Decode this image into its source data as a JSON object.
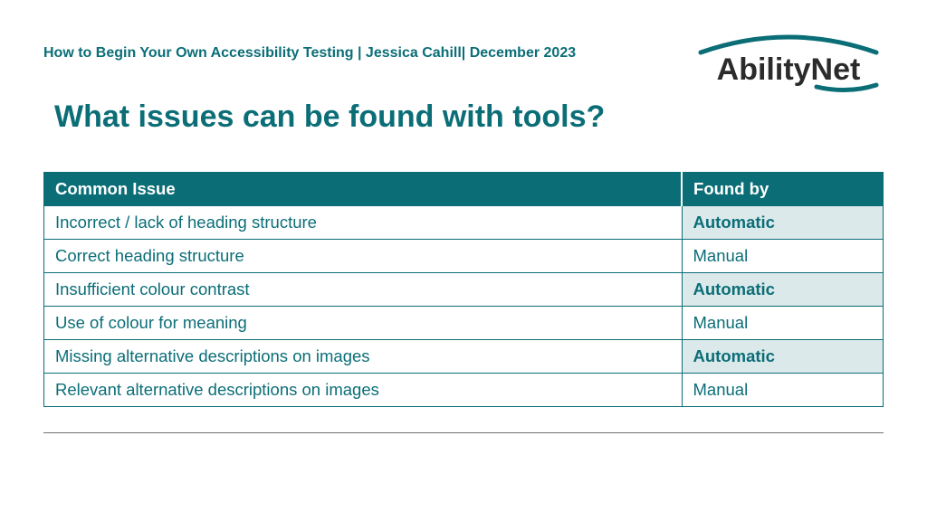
{
  "header": {
    "breadcrumb": "How to Begin Your Own Accessibility Testing | Jessica Cahill| December 2023",
    "logo_text": "AbilityNet"
  },
  "title": "What issues can be found with tools?",
  "table": {
    "headers": {
      "issue": "Common Issue",
      "found_by": "Found by"
    },
    "rows": [
      {
        "issue": "Incorrect / lack of heading structure",
        "found_by": "Automatic",
        "auto": true
      },
      {
        "issue": "Correct heading structure",
        "found_by": "Manual",
        "auto": false
      },
      {
        "issue": "Insufficient colour contrast",
        "found_by": "Automatic",
        "auto": true
      },
      {
        "issue": "Use of colour for meaning",
        "found_by": "Manual",
        "auto": false
      },
      {
        "issue": "Missing alternative descriptions on images",
        "found_by": "Automatic",
        "auto": true
      },
      {
        "issue": "Relevant alternative descriptions on images",
        "found_by": "Manual",
        "auto": false
      }
    ]
  },
  "colors": {
    "teal": "#0b6e77",
    "auto_bg": "#dce9eb"
  }
}
